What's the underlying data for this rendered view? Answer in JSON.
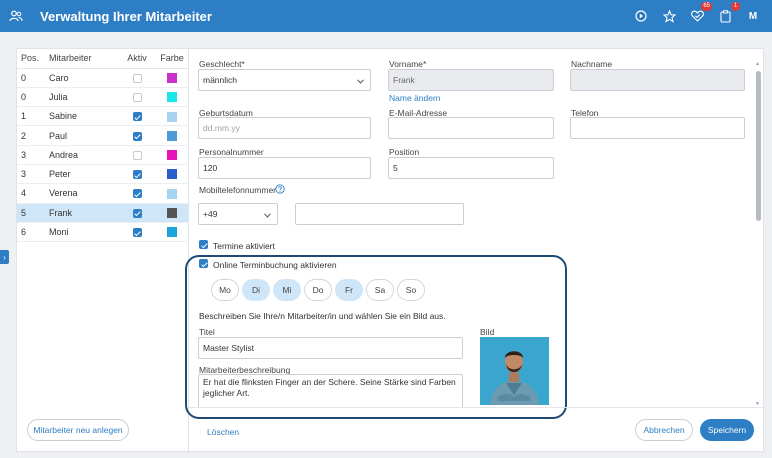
{
  "topbar": {
    "title": "Verwaltung Ihrer Mitarbeiter",
    "badge_favorites": "65",
    "badge_tasks": "1",
    "avatar": "M",
    "icons": [
      "users-icon",
      "play-circle-icon",
      "star-outline-icon",
      "heart-check-icon",
      "clipboard-icon"
    ]
  },
  "employees": {
    "headers": {
      "pos": "Pos.",
      "name": "Mitarbeiter",
      "active": "Aktiv",
      "color": "Farbe"
    },
    "rows": [
      {
        "pos": "0",
        "name": "Caro",
        "active": false,
        "color": "#c832c8"
      },
      {
        "pos": "0",
        "name": "Julia",
        "active": false,
        "color": "#19e6e6"
      },
      {
        "pos": "1",
        "name": "Sabine",
        "active": true,
        "color": "#a6d4ee"
      },
      {
        "pos": "2",
        "name": "Paul",
        "active": true,
        "color": "#4f9ad6"
      },
      {
        "pos": "3",
        "name": "Andrea",
        "active": false,
        "color": "#e614b4"
      },
      {
        "pos": "3",
        "name": "Peter",
        "active": true,
        "color": "#2860c8"
      },
      {
        "pos": "4",
        "name": "Verena",
        "active": true,
        "color": "#a6d4ee"
      },
      {
        "pos": "5",
        "name": "Frank",
        "active": true,
        "color": "#555555"
      },
      {
        "pos": "6",
        "name": "Moni",
        "active": true,
        "color": "#1ea6d8"
      }
    ],
    "selected_index": 7,
    "new_button": "Mitarbeiter neu anlegen"
  },
  "form": {
    "gender": {
      "label": "Geschlecht*",
      "value": "männlich"
    },
    "firstname": {
      "label": "Vorname*",
      "value": "Frank"
    },
    "rename_link": "Name ändern",
    "lastname": {
      "label": "Nachname",
      "value": ""
    },
    "birthdate": {
      "label": "Geburtsdatum",
      "placeholder": "dd.mm.yy"
    },
    "email": {
      "label": "E-Mail-Adresse",
      "value": ""
    },
    "phone": {
      "label": "Telefon",
      "value": ""
    },
    "staff_number": {
      "label": "Personalnummer",
      "value": "120"
    },
    "position": {
      "label": "Position",
      "value": "5"
    },
    "mobile": {
      "label": "Mobiltelefonnummer",
      "prefix": "+49",
      "value": ""
    },
    "appointments_enabled": {
      "label": "Termine aktiviert",
      "checked": true
    },
    "online_booking": {
      "label": "Online Terminbuchung aktivieren",
      "checked": true,
      "days": [
        {
          "label": "Mo",
          "active": false
        },
        {
          "label": "Di",
          "active": true
        },
        {
          "label": "Mi",
          "active": true
        },
        {
          "label": "Do",
          "active": false
        },
        {
          "label": "Fr",
          "active": true
        },
        {
          "label": "Sa",
          "active": false
        },
        {
          "label": "So",
          "active": false
        }
      ],
      "description": "Beschreiben Sie Ihre/n Mitarbeiter/in und wählen Sie ein Bild aus.",
      "title_label": "Titel",
      "title_value": "Master Stylist",
      "desc_label": "Mitarbeiterbeschreibung",
      "desc_value": "Er hat die flinksten Finger an der Schere. Seine Stärke sind Farben jeglicher Art.",
      "image_label": "Bild"
    },
    "delete_link": "Löschen",
    "cancel_button": "Abbrechen",
    "save_button": "Speichern"
  },
  "colors": {
    "accent": "#2d7ec4",
    "frame": "#1e4a74",
    "day_active": "#cfe6f8"
  }
}
